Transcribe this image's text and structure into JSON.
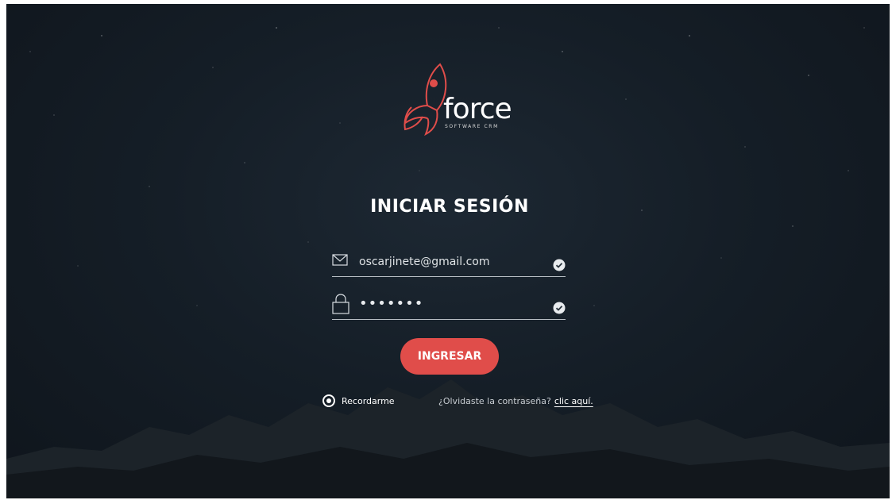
{
  "brand": {
    "name": "force",
    "tagline": "SOFTWARE CRM",
    "accent_color": "#e04d4a",
    "logo_icon": "rocket-icon"
  },
  "login": {
    "title": "INICIAR SESIÓN",
    "email": {
      "icon": "envelope-icon",
      "value": "oscarjinete@gmail.com",
      "status_icon": "check-circle-icon"
    },
    "password": {
      "icon": "lock-icon",
      "value": "•••••••",
      "status_icon": "check-circle-icon"
    },
    "submit_label": "INGRESAR",
    "remember_label": "Recordarme",
    "forgot_text": "¿Olvidaste la contraseña?",
    "forgot_link": "clic aquí."
  }
}
